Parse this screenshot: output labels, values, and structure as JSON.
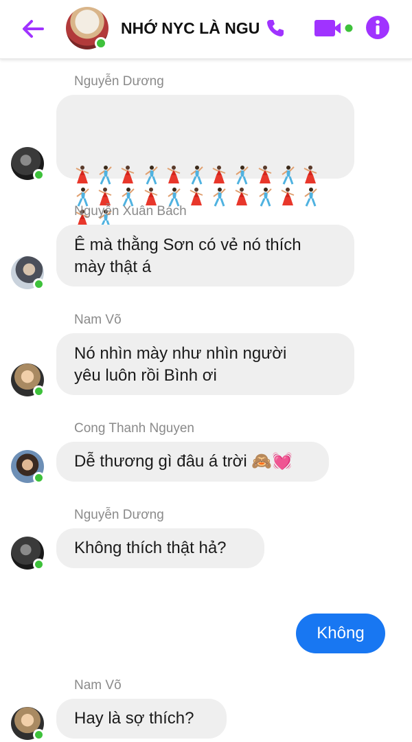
{
  "header": {
    "title": "NHỚ NYC LÀ NGU",
    "icons": {
      "back": "arrow-left-icon",
      "call": "phone-icon",
      "video": "video-camera-icon",
      "info": "info-icon"
    },
    "accent_color": "#a033ff",
    "online_color": "#3ec13b"
  },
  "messages": [
    {
      "sender": "Nguyễn Dương",
      "type": "emoji",
      "emoji": "💃🕺",
      "emoji_count": 24
    },
    {
      "sender": "Nguyễn Xuân Bách",
      "lines": [
        "Ê mà thằng Sơn có vẻ nó thích",
        "mày thật á"
      ]
    },
    {
      "sender": "Nam Võ",
      "lines": [
        "Nó nhìn mày như nhìn người",
        "yêu luôn rồi Bình ơi"
      ]
    },
    {
      "sender": "Cong Thanh Nguyen",
      "text": "Dễ thương gì đâu á trời 🙈💓"
    },
    {
      "sender": "Nguyễn Dương",
      "text": "Không thích thật hả?"
    },
    {
      "sender": "me",
      "text": "Không",
      "color": "#1877f2"
    },
    {
      "sender": "Nam Võ",
      "text": "Hay là sợ thích?"
    }
  ]
}
